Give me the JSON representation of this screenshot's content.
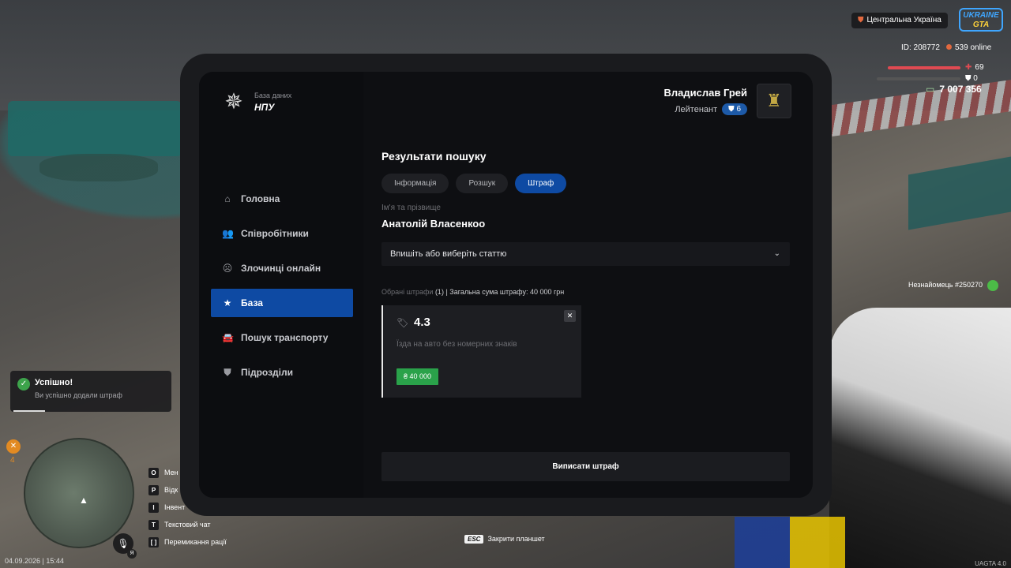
{
  "hud": {
    "region": "Центральна Україна",
    "logo_line1": "UKRAINE",
    "logo_line2": "GTA",
    "player_id": "ID: 208772",
    "online": "539 online",
    "health": "69",
    "armor": "0",
    "money": "7 007 356",
    "stranger": "Незнайомець #250270",
    "hunger": "4",
    "datetime": "04.09.2026 | 15:44",
    "version": "UAGTA 4.0",
    "mic_key": "Я"
  },
  "toast": {
    "title": "Успішно!",
    "text": "Ви успішно додали штраф"
  },
  "keybinds": [
    {
      "key": "O",
      "label": "Мен"
    },
    {
      "key": "P",
      "label": "Відк"
    },
    {
      "key": "I",
      "label": "Інвент"
    },
    {
      "key": "T",
      "label": "Текстовий чат"
    },
    {
      "key": "[ ]",
      "label": "Перемикання рації"
    }
  ],
  "esc_hint": {
    "key": "ESC",
    "label": "Закрити планшет"
  },
  "tablet": {
    "brand": {
      "subtitle": "База даних",
      "title": "НПУ"
    },
    "nav": [
      {
        "label": "Головна",
        "icon": "home-icon",
        "glyph": "⌂",
        "active": false
      },
      {
        "label": "Співробітники",
        "icon": "people-icon",
        "glyph": "👥",
        "active": false
      },
      {
        "label": "Злочинці онлайн",
        "icon": "criminal-icon",
        "glyph": "☹",
        "active": false
      },
      {
        "label": "База",
        "icon": "star-icon",
        "glyph": "★",
        "active": true
      },
      {
        "label": "Пошук транспорту",
        "icon": "car-icon",
        "glyph": "🚘",
        "active": false
      },
      {
        "label": "Підрозділи",
        "icon": "shield-icon",
        "glyph": "⛊",
        "active": false
      }
    ],
    "user": {
      "name": "Владислав Грей",
      "rank": "Лейтенант",
      "level": "6"
    },
    "page_title": "Результати пошуку",
    "tabs": [
      {
        "label": "Інформація",
        "active": false
      },
      {
        "label": "Розшук",
        "active": false
      },
      {
        "label": "Штраф",
        "active": true
      }
    ],
    "field_label": "Ім'я та прізвище",
    "person_name": "Анатолій Власенкоо",
    "select_placeholder": "Впишіть або виберіть статтю",
    "summary": {
      "prefix": "Обрані штрафи",
      "count": "(1)",
      "total": "| Загальна сума штрафу: 40 000 грн"
    },
    "fine": {
      "code": "4.3",
      "description": "Їзда на авто без номерних знаків",
      "amount": "₴ 40 000"
    },
    "submit_label": "Виписати штраф"
  },
  "colors": {
    "accent": "#0e4aa3",
    "success": "#2aa24a",
    "panel": "#0e0f12"
  }
}
